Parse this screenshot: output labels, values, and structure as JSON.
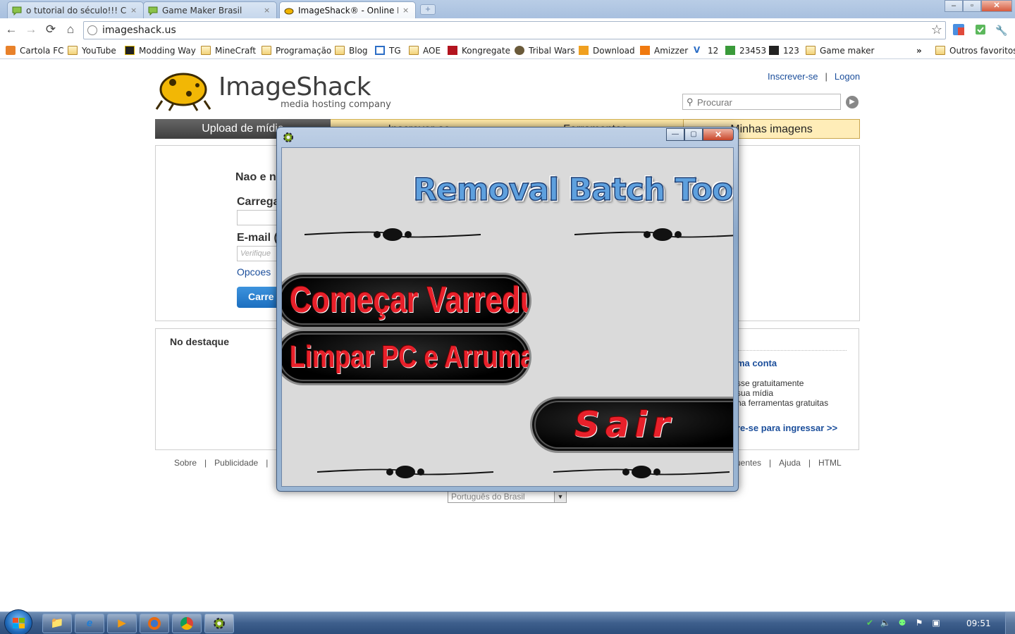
{
  "tabs": [
    {
      "label": "o tutorial do século!!! CO…",
      "active": false
    },
    {
      "label": "Game Maker Brasil",
      "active": false
    },
    {
      "label": "ImageShack® - Online P…",
      "active": true
    }
  ],
  "tab_close_glyph": "×",
  "newtab_glyph": "+",
  "browser": {
    "url": "imageshack.us",
    "bookmarks": [
      {
        "label": "Cartola FC",
        "icon": "cartola-icon"
      },
      {
        "label": "YouTube",
        "icon": "folder-icon"
      },
      {
        "label": "Modding Way",
        "icon": "moddingway-icon"
      },
      {
        "label": "MineCraft",
        "icon": "folder-icon"
      },
      {
        "label": "Programação",
        "icon": "folder-icon"
      },
      {
        "label": "Blog",
        "icon": "folder-icon"
      },
      {
        "label": "TG",
        "icon": "tg-icon"
      },
      {
        "label": "AOE",
        "icon": "folder-icon"
      },
      {
        "label": "Kongregate",
        "icon": "kongregate-icon"
      },
      {
        "label": "Tribal Wars",
        "icon": "tribalwars-icon"
      },
      {
        "label": "Download",
        "icon": "download-icon"
      },
      {
        "label": "Amizzer",
        "icon": "amizzer-icon"
      },
      {
        "label": "12",
        "icon": "v-icon"
      },
      {
        "label": "23453",
        "icon": "s-icon"
      },
      {
        "label": "123",
        "icon": "qv-icon"
      },
      {
        "label": "Game maker",
        "icon": "folder-icon"
      }
    ],
    "more_bookmarks": "»",
    "other_bookmarks": "Outros favoritos"
  },
  "imageshack": {
    "logo_title": "ImageShack",
    "logo_sub": "media hosting company",
    "signup_link": "Inscrever-se",
    "login_link": "Logon",
    "top_sep": "|",
    "search_placeholder": "Procurar",
    "nav": [
      "Upload de mídia",
      "Inscrever-se",
      "Ferramentas",
      "Minhas imagens"
    ],
    "upload": {
      "notice": "Nao e n",
      "load_label": "Carrega",
      "email_label": "E-mail (",
      "email_placeholder": "Verifique",
      "options_link": "Opcoes",
      "upload_button": "Carre"
    },
    "featured_title": "No destaque",
    "account": {
      "title": "ma conta",
      "benefits": [
        "sse gratuitamente",
        "sua mídia",
        "ha ferramentas gratuitas"
      ],
      "signup_cta": "re-se para ingressar >>"
    },
    "footer_left": [
      "Sobre",
      "Publicidade"
    ],
    "footer_right": [
      "uentes",
      "Ajuda",
      "HTML"
    ],
    "footer_sep": "|",
    "language": "Português do Brasil"
  },
  "game_window": {
    "title_art": "Removal Batch Tool",
    "scan_button": "Começar Varredura",
    "clean_button": "Limpar PC e Arrumar Erros",
    "exit_button": "Sair",
    "min_glyph": "—",
    "max_glyph": "▢",
    "close_glyph": "✕"
  },
  "taskbar": {
    "clock": "09:51"
  },
  "colors": {
    "accent_blue": "#1b4e9b",
    "game_button_text": "#e8202a",
    "nav_yellow": "#ffe9a8"
  }
}
